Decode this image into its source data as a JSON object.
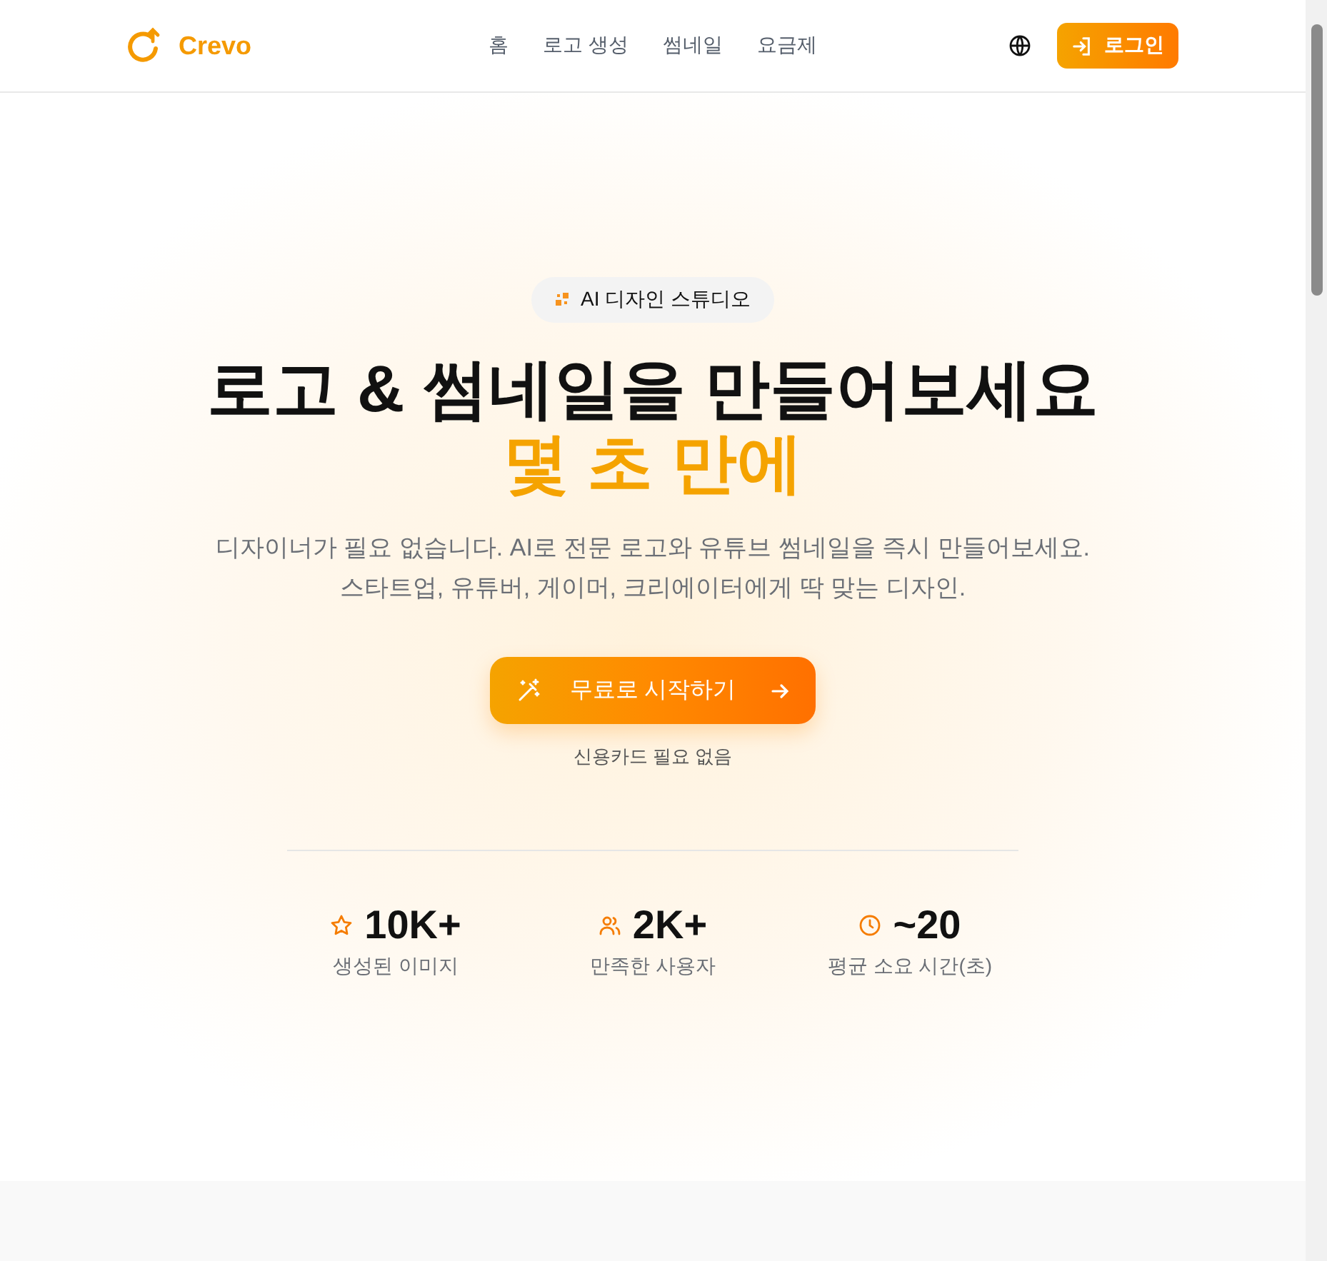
{
  "header": {
    "brand": "Crevo",
    "nav": [
      {
        "label": "홈"
      },
      {
        "label": "로고 생성"
      },
      {
        "label": "썸네일"
      },
      {
        "label": "요금제"
      }
    ],
    "login": "로그인"
  },
  "hero": {
    "badge": "AI 디자인 스튜디오",
    "title": "로고 & 썸네일을 만들어보세요",
    "title_accent": "몇 초 만에",
    "subtitle": [
      "디자이너가 필요 없습니다. AI로 전문 로고와 유튜브 썸네일을 즉시 만들어보세요.",
      "스타트업, 유튜버, 게이머, 크리에이터에게 딱 맞는 디자인."
    ],
    "cta": "무료로 시작하기",
    "note": "신용카드 필요 없음"
  },
  "stats": [
    {
      "kind": "star",
      "value": "10K+",
      "label": "생성된 이미지"
    },
    {
      "kind": "users",
      "value": "2K+",
      "label": "만족한 사용자"
    },
    {
      "kind": "clock",
      "value": "~20",
      "label": "평균 소요 시간(초)"
    }
  ]
}
